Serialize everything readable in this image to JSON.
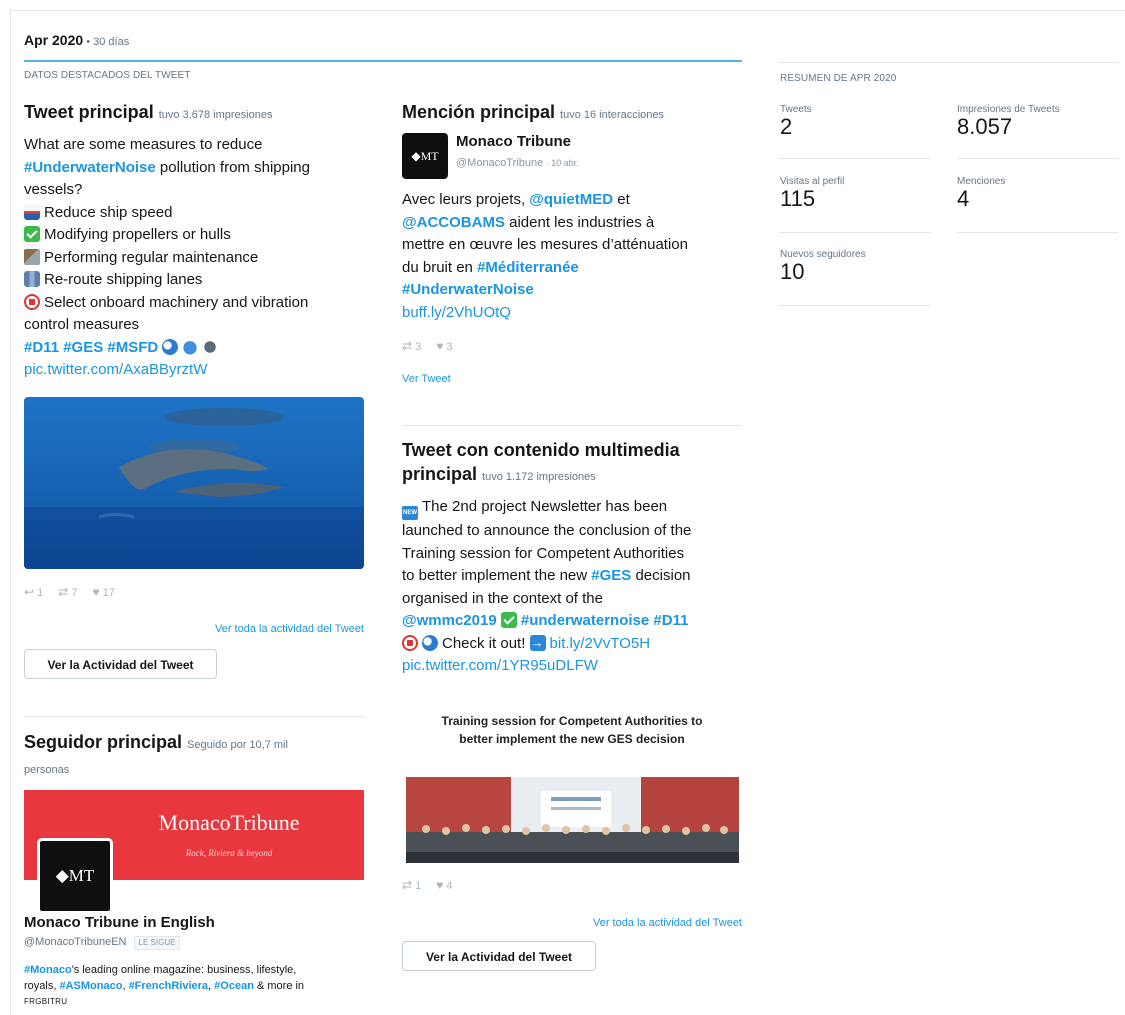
{
  "header": {
    "title": "Apr 2020",
    "period": " • 30 días"
  },
  "highlights_label": "DATOS DESTACADOS DEL TWEET",
  "top_tweet": {
    "title": "Tweet principal",
    "note": "tuvo 3.678 impresiones",
    "line1": "What are some measures to reduce",
    "hashtag_underwater": "#UnderwaterNoise",
    "line2_rest": " pollution from shipping",
    "line3": "vessels?",
    "items": [
      {
        "icon": "ship-icon",
        "text": "Reduce ship speed"
      },
      {
        "icon": "check-icon",
        "text": "Modifying propellers or hulls"
      },
      {
        "icon": "tools-icon",
        "text": "Performing regular maintenance"
      },
      {
        "icon": "map-icon",
        "text": "Re-route shipping lanes"
      },
      {
        "icon": "mute-icon",
        "text": "Select onboard machinery and vibration"
      }
    ],
    "line_control": "control measures",
    "tags": "#D11 #GES #MSFD",
    "pic_link": "pic.twitter.com/AxaBByrztW",
    "replies": "1",
    "retweets": "7",
    "likes": "17",
    "activity_link": "Ver toda la actividad del Tweet",
    "activity_button": "Ver la Actividad del Tweet"
  },
  "top_mention": {
    "title": "Mención principal",
    "note": "tuvo 16 interacciones",
    "author_name": "Monaco Tribune",
    "author_handle": "@MonacoTribune",
    "date": " · 10 abr.",
    "avatar_text": "◆MT",
    "text_pre": "Avec leurs projets, ",
    "mention1": "@quietMED",
    "text_et": " et",
    "mention2": "@ACCOBAMS",
    "text_mid": " aident les industries à",
    "text_line3": "mettre en œuvre les mesures d’atténuation",
    "text_line4_pre": "du bruit en ",
    "hashtag_med": "#Méditerranée",
    "hashtag_noise": "#UnderwaterNoise",
    "link": "buff.ly/2VhUOtQ",
    "retweets": "3",
    "likes": "3",
    "view_tweet": "Ver Tweet"
  },
  "top_media": {
    "title_line1": "Tweet con contenido multimedia",
    "title_line2": "principal",
    "note": "tuvo 1.172 impresiones",
    "l1": "The 2nd project Newsletter has been",
    "l2": "launched to announce the conclusion of the",
    "l3": "Training session for Competent Authorities",
    "l4_pre": "to better implement the new ",
    "l4_tag": "#GES",
    "l4_post": " decision",
    "l5": "organised in the context of the",
    "l6_mention": "@wmmc2019",
    "l6_tag1": "#underwaternoise",
    "l6_tag2": "#D11",
    "l7_text": "Check it out!",
    "l7_link": "bit.ly/2VvTO5H",
    "pic_link": "pic.twitter.com/1YR95uDLFW",
    "image_caption_1": "Training session for Competent Authorities to",
    "image_caption_2": "better implement the new GES decision",
    "retweets": "1",
    "likes": "4",
    "activity_link": "Ver toda la actividad del Tweet",
    "activity_button": "Ver la Actividad del Tweet"
  },
  "top_follower": {
    "title": "Seguidor principal",
    "note_1": "Seguido por 10,7 mil",
    "note_2": "personas",
    "banner_name": "MonacoTribune",
    "banner_tagline": "Rock, Riviera & beyond",
    "avatar_text": "◆MT",
    "name": "Monaco Tribune in English",
    "handle": "@MonacoTribuneEN",
    "follows_badge": "LE SIGUE",
    "bio_tag1": "#Monaco",
    "bio_1": "'s leading online magazine: business, lifestyle,",
    "bio_2_pre": "royals, ",
    "bio_tag2": "#ASMonaco",
    "bio_tag3": "#FrenchRiviera",
    "bio_tag4": "#Ocean",
    "bio_2_post": " & more in",
    "bio_3": "FRGBITRU"
  },
  "summary": {
    "label": "RESUMEN DE APR 2020",
    "tweets_label": "Tweets",
    "tweets_value": "2",
    "impressions_label": "Impresiones de Tweets",
    "impressions_value": "8.057",
    "profile_visits_label": "Visitas al perfil",
    "profile_visits_value": "115",
    "mentions_label": "Menciones",
    "mentions_value": "4",
    "new_followers_label": "Nuevos seguidores",
    "new_followers_value": "10"
  },
  "colors": {
    "link": "#1b95e0",
    "rule": "#5aaee6",
    "banner": "#e8373f"
  }
}
